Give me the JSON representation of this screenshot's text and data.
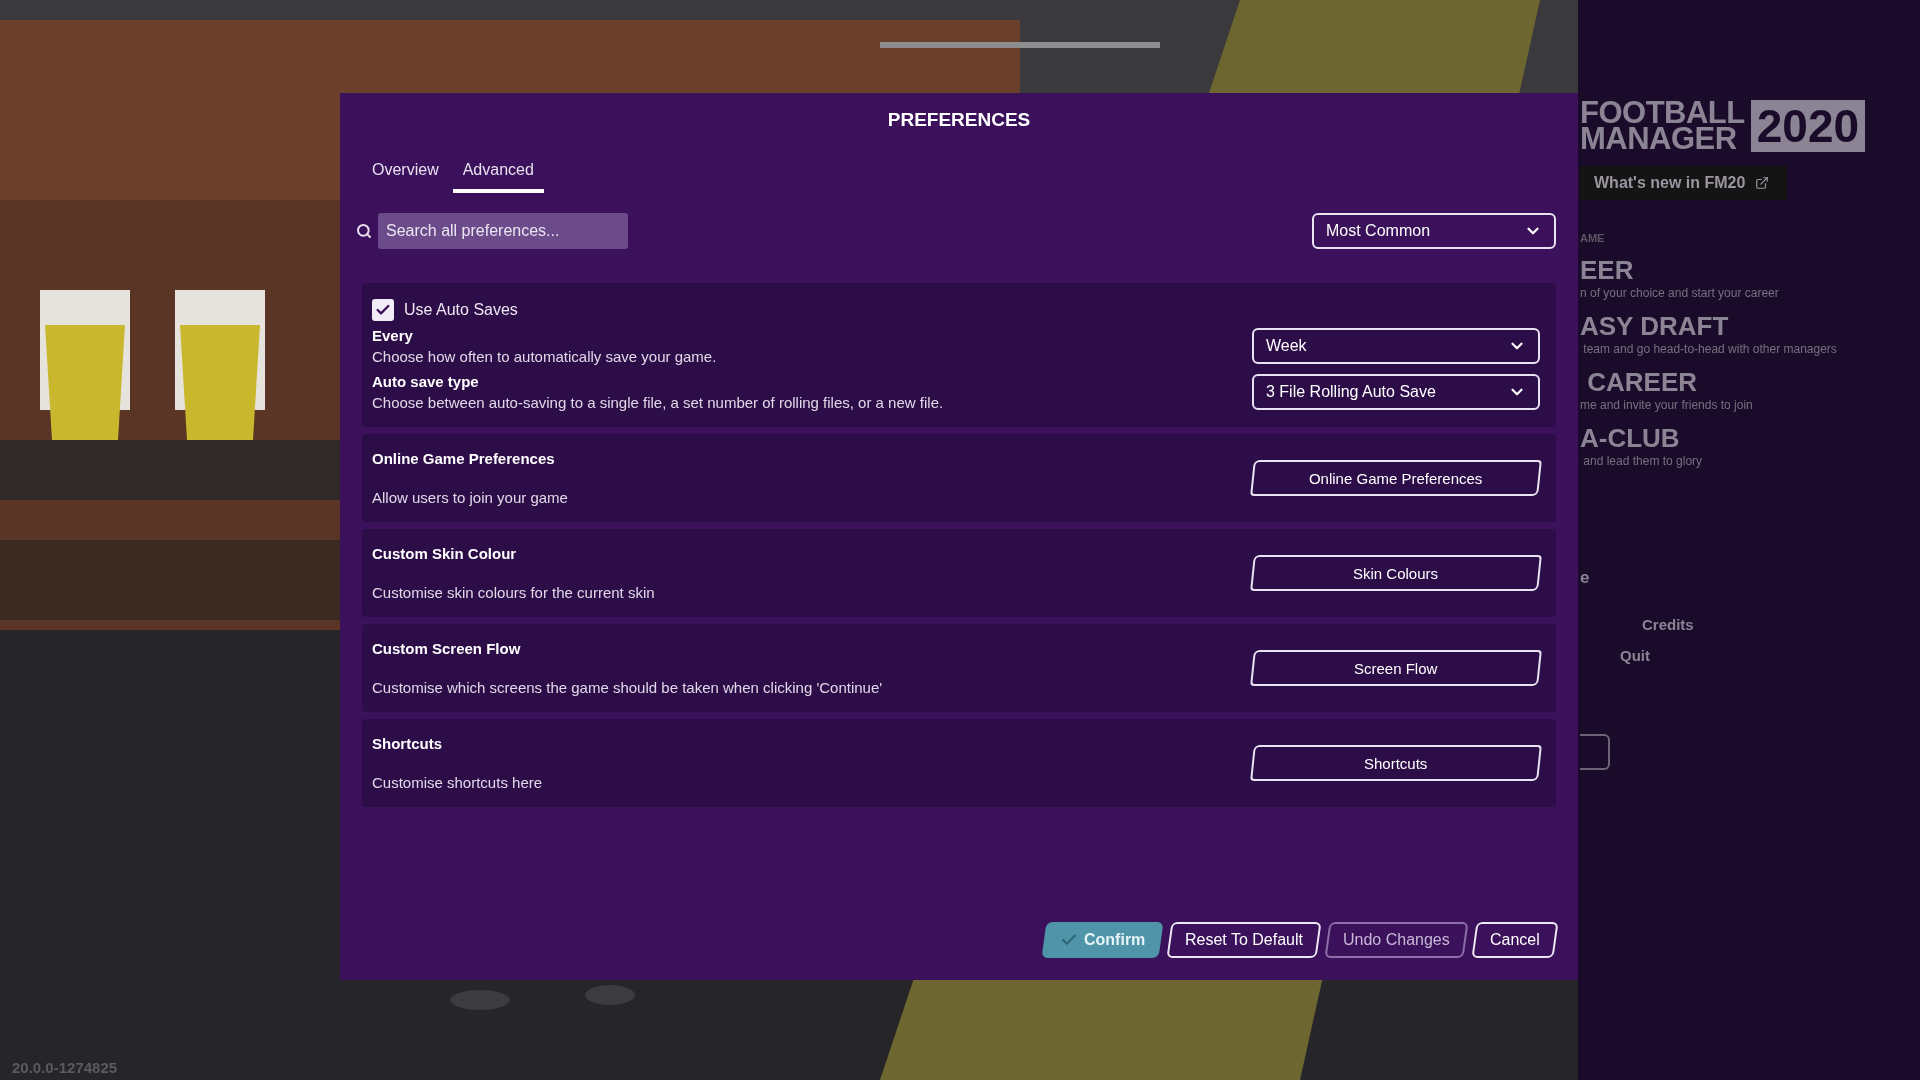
{
  "main_menu": {
    "logo": {
      "line_1": "FOOTBALL",
      "line_2": "MANAGER",
      "year": "2020"
    },
    "whats_new": "What's new in FM20",
    "section_label": "AME",
    "items": [
      {
        "title": "EER",
        "subtitle": "n of your choice and start your career"
      },
      {
        "title": "ASY DRAFT",
        "subtitle": " team and go head-to-head with other managers"
      },
      {
        "title": " CAREER",
        "subtitle": "me and invite your friends to join"
      },
      {
        "title": "A-CLUB",
        "subtitle": " and lead them to glory"
      }
    ],
    "partial_item": "e",
    "links": [
      "Credits",
      "Quit"
    ]
  },
  "version": "20.0.0-1274825",
  "dialog": {
    "title": "PREFERENCES",
    "tabs": [
      {
        "label": "Overview",
        "selected": false
      },
      {
        "label": "Advanced",
        "selected": true
      }
    ],
    "search": {
      "placeholder": "Search all preferences..."
    },
    "filter": {
      "value": "Most Common"
    },
    "groups": [
      {
        "kind": "autosave",
        "checkbox": {
          "label": "Use Auto Saves",
          "checked": true
        },
        "settings": [
          {
            "title": "Every",
            "description": "Choose how often to automatically save your game.",
            "value": "Week"
          },
          {
            "title": "Auto save type",
            "description": "Choose between auto-saving to a single file, a set number of rolling files, or a new file.",
            "value": "3 File Rolling Auto Save"
          }
        ]
      },
      {
        "kind": "action",
        "title": "Online Game Preferences",
        "description": "Allow users to join your game",
        "button": "Online Game Preferences"
      },
      {
        "kind": "action",
        "title": "Custom Skin Colour",
        "description": "Customise skin colours for the current skin",
        "button": "Skin Colours"
      },
      {
        "kind": "action",
        "title": "Custom Screen Flow",
        "description": "Customise which screens the game should be taken when clicking 'Continue'",
        "button": "Screen Flow"
      },
      {
        "kind": "action",
        "title": "Shortcuts",
        "description": "Customise shortcuts here",
        "button": "Shortcuts"
      }
    ],
    "footer_buttons": [
      {
        "label": "Confirm",
        "kind": "primary",
        "disabled": false
      },
      {
        "label": "Reset To Default",
        "kind": "outline",
        "disabled": false
      },
      {
        "label": "Undo Changes",
        "kind": "outline",
        "disabled": true
      },
      {
        "label": "Cancel",
        "kind": "outline",
        "disabled": false
      }
    ]
  }
}
